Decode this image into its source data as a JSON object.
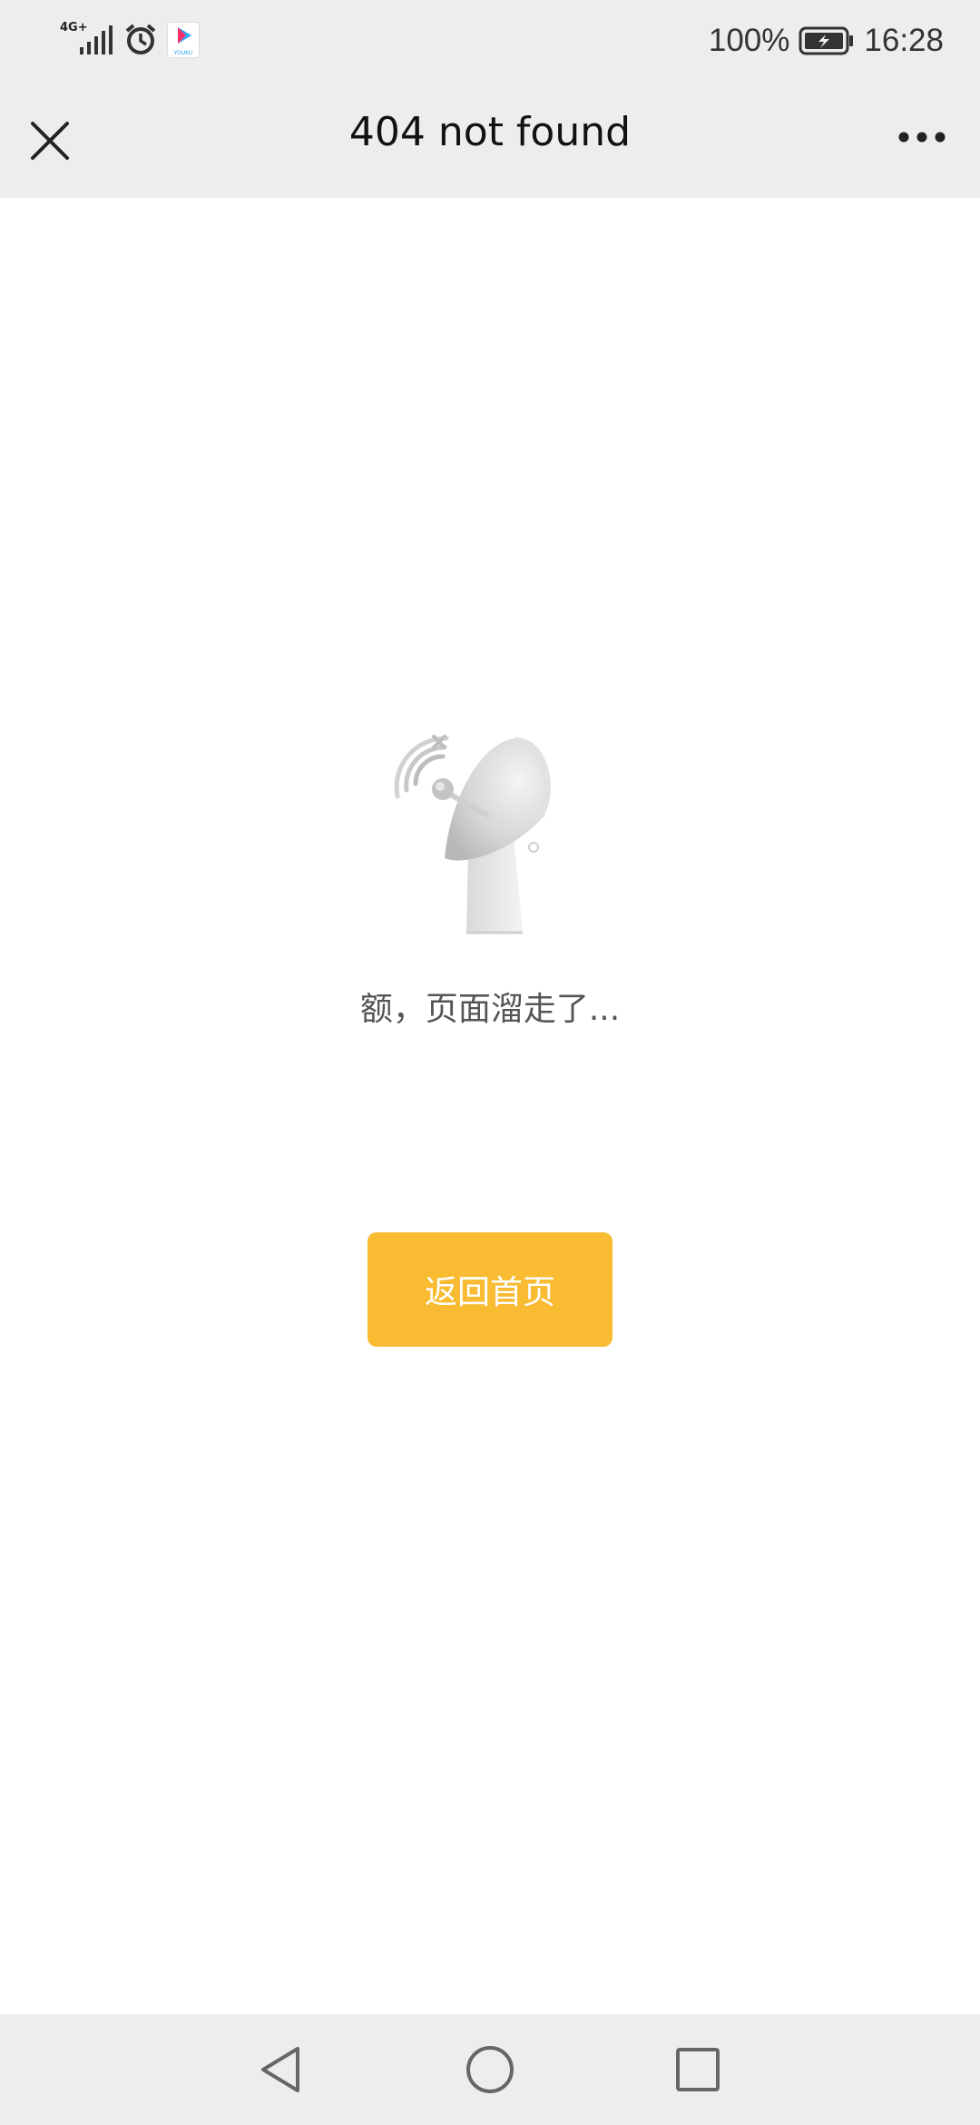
{
  "status_bar": {
    "network": "4G+",
    "battery": "100%",
    "time": "16:28",
    "app_icon_label": "YOUKU",
    "icons": [
      "signal-icon",
      "alarm-icon",
      "youku-app-icon",
      "battery-charging-icon"
    ]
  },
  "nav": {
    "title": "404 not found",
    "close_icon": "close-icon",
    "more_icon": "more-icon"
  },
  "main": {
    "illustration": "satellite-dish-icon",
    "message": "额，页面溜走了...",
    "home_button": "返回首页"
  },
  "colors": {
    "accent": "#f8bb32",
    "bars": "#ededed",
    "text": "#555555"
  },
  "system_nav": {
    "icons": [
      "back-icon",
      "home-icon",
      "recents-icon"
    ]
  }
}
